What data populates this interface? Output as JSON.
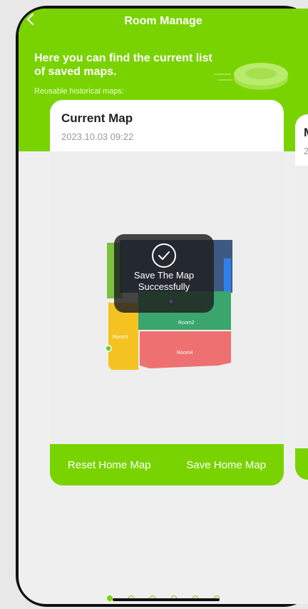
{
  "header": {
    "title": "Room Manage",
    "back_icon": "chevron-left-icon"
  },
  "hero": {
    "title": "Here you can find the current list of saved maps.",
    "subtitle": "Reusable historical maps:"
  },
  "current_card": {
    "title": "Current Map",
    "date": "2023.10.03 09:22",
    "rooms": [
      "Room2",
      "Room1",
      "Room4"
    ],
    "actions": {
      "reset": "Reset Home Map",
      "save": "Save Home Map"
    }
  },
  "next_card": {
    "title": "M",
    "date": "2"
  },
  "toast": {
    "icon": "check-circle-icon",
    "text_line1": "Save The Map",
    "text_line2": "Successfully"
  },
  "pager": {
    "count": 6,
    "active": 1
  },
  "colors": {
    "accent": "#79d300",
    "room_green": "#3aa66e",
    "room_yellow": "#f4c322",
    "room_red": "#ee7070",
    "room_blue": "#2f80ed"
  }
}
